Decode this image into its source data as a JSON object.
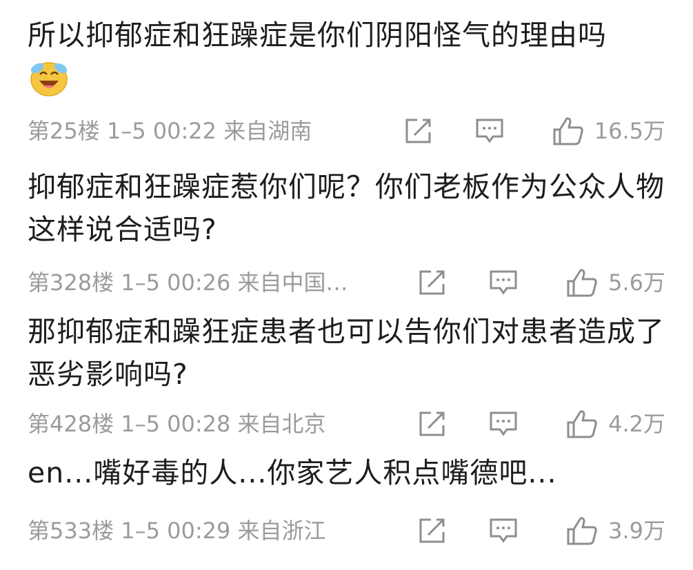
{
  "comments": [
    {
      "content": "所以抑郁症和狂躁症是你们阴阳怪气的理由吗",
      "emoji": "laugh-cry-emoji",
      "floor": "第25楼",
      "time": "1–5 00:22",
      "location": "来自湖南",
      "likes": "16.5万"
    },
    {
      "content": "抑郁症和狂躁症惹你们呢？你们老板作为公众人物 这样说合适吗?",
      "floor": "第328楼",
      "time": "1–5 00:26",
      "location": "来自中国…",
      "likes": "5.6万"
    },
    {
      "content": "那抑郁症和躁狂症患者也可以告你们对患者造成了恶劣影响吗?",
      "floor": "第428楼",
      "time": "1–5 00:28",
      "location": "来自北京",
      "likes": "4.2万"
    },
    {
      "content": "en...嘴好毒的人...你家艺人积点嘴德吧...",
      "floor": "第533楼",
      "time": "1–5 00:29",
      "location": "来自浙江",
      "likes": "3.9万"
    }
  ],
  "icons": {
    "share": "share-icon",
    "reply": "comment-icon",
    "like": "thumbs-up-icon"
  },
  "colors": {
    "text": "#1d1d1d",
    "meta": "#9b9b9b",
    "icon": "#8e8e8e",
    "emoji": "#f6c640"
  }
}
